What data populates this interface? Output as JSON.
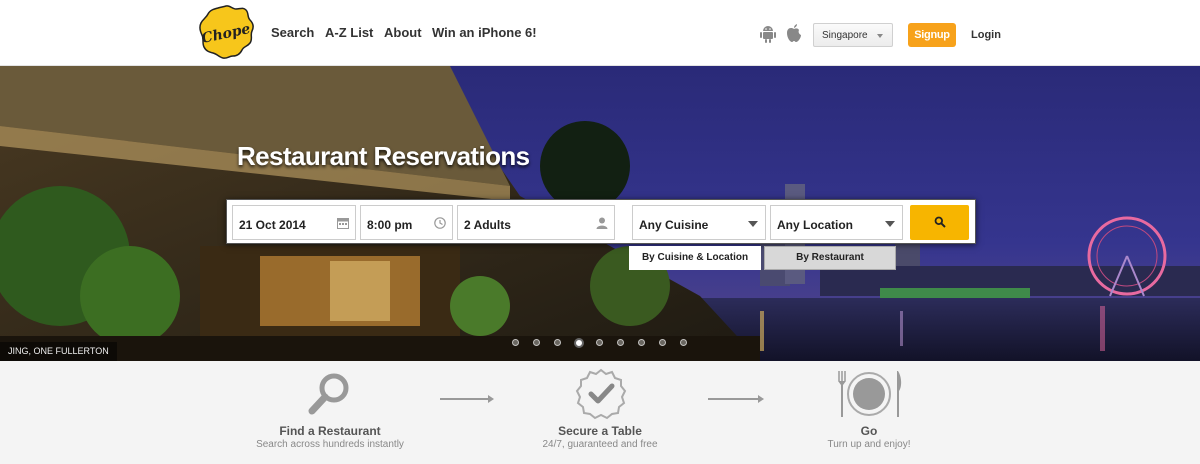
{
  "header": {
    "logo_text": "Chope",
    "nav": [
      "Search",
      "A-Z List",
      "About",
      "Win an iPhone 6!"
    ],
    "country": "Singapore",
    "signup_label": "Signup",
    "login_label": "Login",
    "brand_yellow": "#f7c61b",
    "signup_color": "#f7a21b"
  },
  "hero": {
    "title": "Restaurant Reservations",
    "caption": "JING, ONE FULLERTON",
    "search": {
      "date": "21 Oct 2014",
      "time": "8:00 pm",
      "guests": "2 Adults",
      "cuisine": "Any Cuisine",
      "location": "Any Location",
      "button_icon": "search-icon",
      "button_color": "#f7b500"
    },
    "tabs": [
      "By Cuisine & Location",
      "By Restaurant"
    ],
    "slides": {
      "count": 9,
      "active": 3
    }
  },
  "steps": [
    {
      "icon": "magnifier-icon",
      "title": "Find a Restaurant",
      "subtitle": "Search across hundreds instantly"
    },
    {
      "icon": "badge-check-icon",
      "title": "Secure a Table",
      "subtitle": "24/7, guaranteed and free"
    },
    {
      "icon": "plate-cutlery-icon",
      "title": "Go",
      "subtitle": "Turn up and enjoy!"
    }
  ]
}
